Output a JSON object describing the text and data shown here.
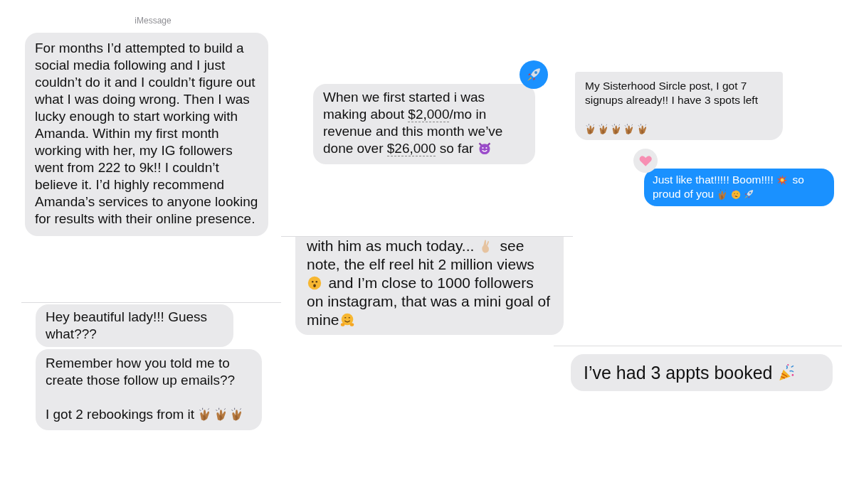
{
  "fragments": [
    {
      "header": "iMessage",
      "messages": [
        {
          "outgoing": false,
          "parts": [
            {
              "kind": "text",
              "text": "For months I’d attempted to build a social media following and I just couldn’t do it and I couldn’t figure out what I was doing wrong. Then I was lucky enough to start working with Amanda. Within my first month working with her, my IG followers went from 222 to 9k!! I couldn’t believe it. I’d highly recommend Amanda’s services to anyone looking for results with their online presence."
            }
          ]
        }
      ]
    },
    {
      "messages": [
        {
          "outgoing": false,
          "parts": [
            {
              "kind": "text",
              "text": "Hey beautiful lady!!! Guess what???"
            }
          ]
        },
        {
          "outgoing": false,
          "parts": [
            {
              "kind": "text",
              "text": "Remember how you told me to create those follow up emails??"
            },
            {
              "kind": "break"
            },
            {
              "kind": "break"
            },
            {
              "kind": "text",
              "text": "I got 2 rebookings from it "
            },
            {
              "kind": "clap"
            },
            {
              "kind": "clap"
            },
            {
              "kind": "clap"
            }
          ]
        }
      ]
    },
    {
      "messages": [
        {
          "outgoing": false,
          "reaction": {
            "kind": "rocket",
            "mine": true
          },
          "parts": [
            {
              "kind": "text",
              "text": "When we first started i was making about "
            },
            {
              "kind": "link",
              "text": "$2,000"
            },
            {
              "kind": "text",
              "text": "/mo in revenue and this month we’ve done over "
            },
            {
              "kind": "link",
              "text": "$26,000"
            },
            {
              "kind": "text",
              "text": " so far "
            },
            {
              "kind": "devil"
            }
          ]
        }
      ]
    },
    {
      "messages": [
        {
          "outgoing": false,
          "parts": [
            {
              "kind": "text",
              "text": "with him as much today... "
            },
            {
              "kind": "fingers"
            },
            {
              "kind": "text",
              "text": " see note, the elf reel hit 2 million views "
            },
            {
              "kind": "surprised"
            },
            {
              "kind": "text",
              "text": " and I’m close to 1000 followers on instagram, that was a mini goal of mine"
            },
            {
              "kind": "hug"
            }
          ]
        }
      ]
    },
    {
      "messages": [
        {
          "outgoing": false,
          "parts": [
            {
              "kind": "text",
              "text": "My Sisterhood Sircle post, I got 7 signups already!! I have 3 spots left"
            },
            {
              "kind": "break"
            },
            {
              "kind": "break"
            },
            {
              "kind": "clap"
            },
            {
              "kind": "clap"
            },
            {
              "kind": "clap"
            },
            {
              "kind": "clap"
            },
            {
              "kind": "clap"
            }
          ]
        },
        {
          "outgoing": true,
          "reaction": {
            "kind": "heart",
            "mine": false
          },
          "parts": [
            {
              "kind": "text",
              "text": "Just like that!!!!! Boom!!!! "
            },
            {
              "kind": "boom"
            },
            {
              "kind": "text",
              "text": " so proud of you "
            },
            {
              "kind": "clap"
            },
            {
              "kind": "party-face"
            },
            {
              "kind": "rocket"
            }
          ]
        }
      ]
    },
    {
      "messages": [
        {
          "outgoing": false,
          "parts": [
            {
              "kind": "text",
              "text": "I’ve had 3 appts booked "
            },
            {
              "kind": "popper"
            }
          ]
        }
      ]
    }
  ]
}
